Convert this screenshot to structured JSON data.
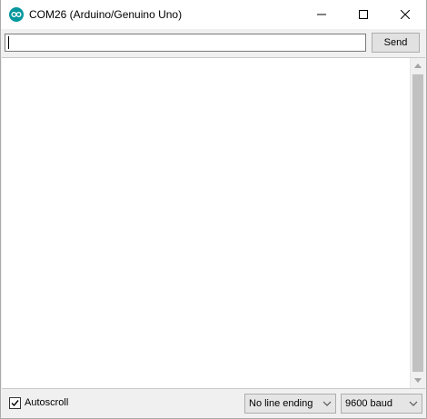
{
  "window": {
    "title": "COM26 (Arduino/Genuino Uno)",
    "app_icon": "arduino-logo-icon",
    "controls": [
      "minimize-icon",
      "maximize-icon",
      "close-icon"
    ]
  },
  "send_bar": {
    "input_value": "",
    "send_label": "Send"
  },
  "output": {
    "text": ""
  },
  "footer": {
    "autoscroll_label": "Autoscroll",
    "autoscroll_checked": true,
    "line_ending_selected": "No line ending",
    "baud_selected": "9600 baud"
  },
  "colors": {
    "accent": "#00979d",
    "window_bg": "#f0f0f0"
  }
}
